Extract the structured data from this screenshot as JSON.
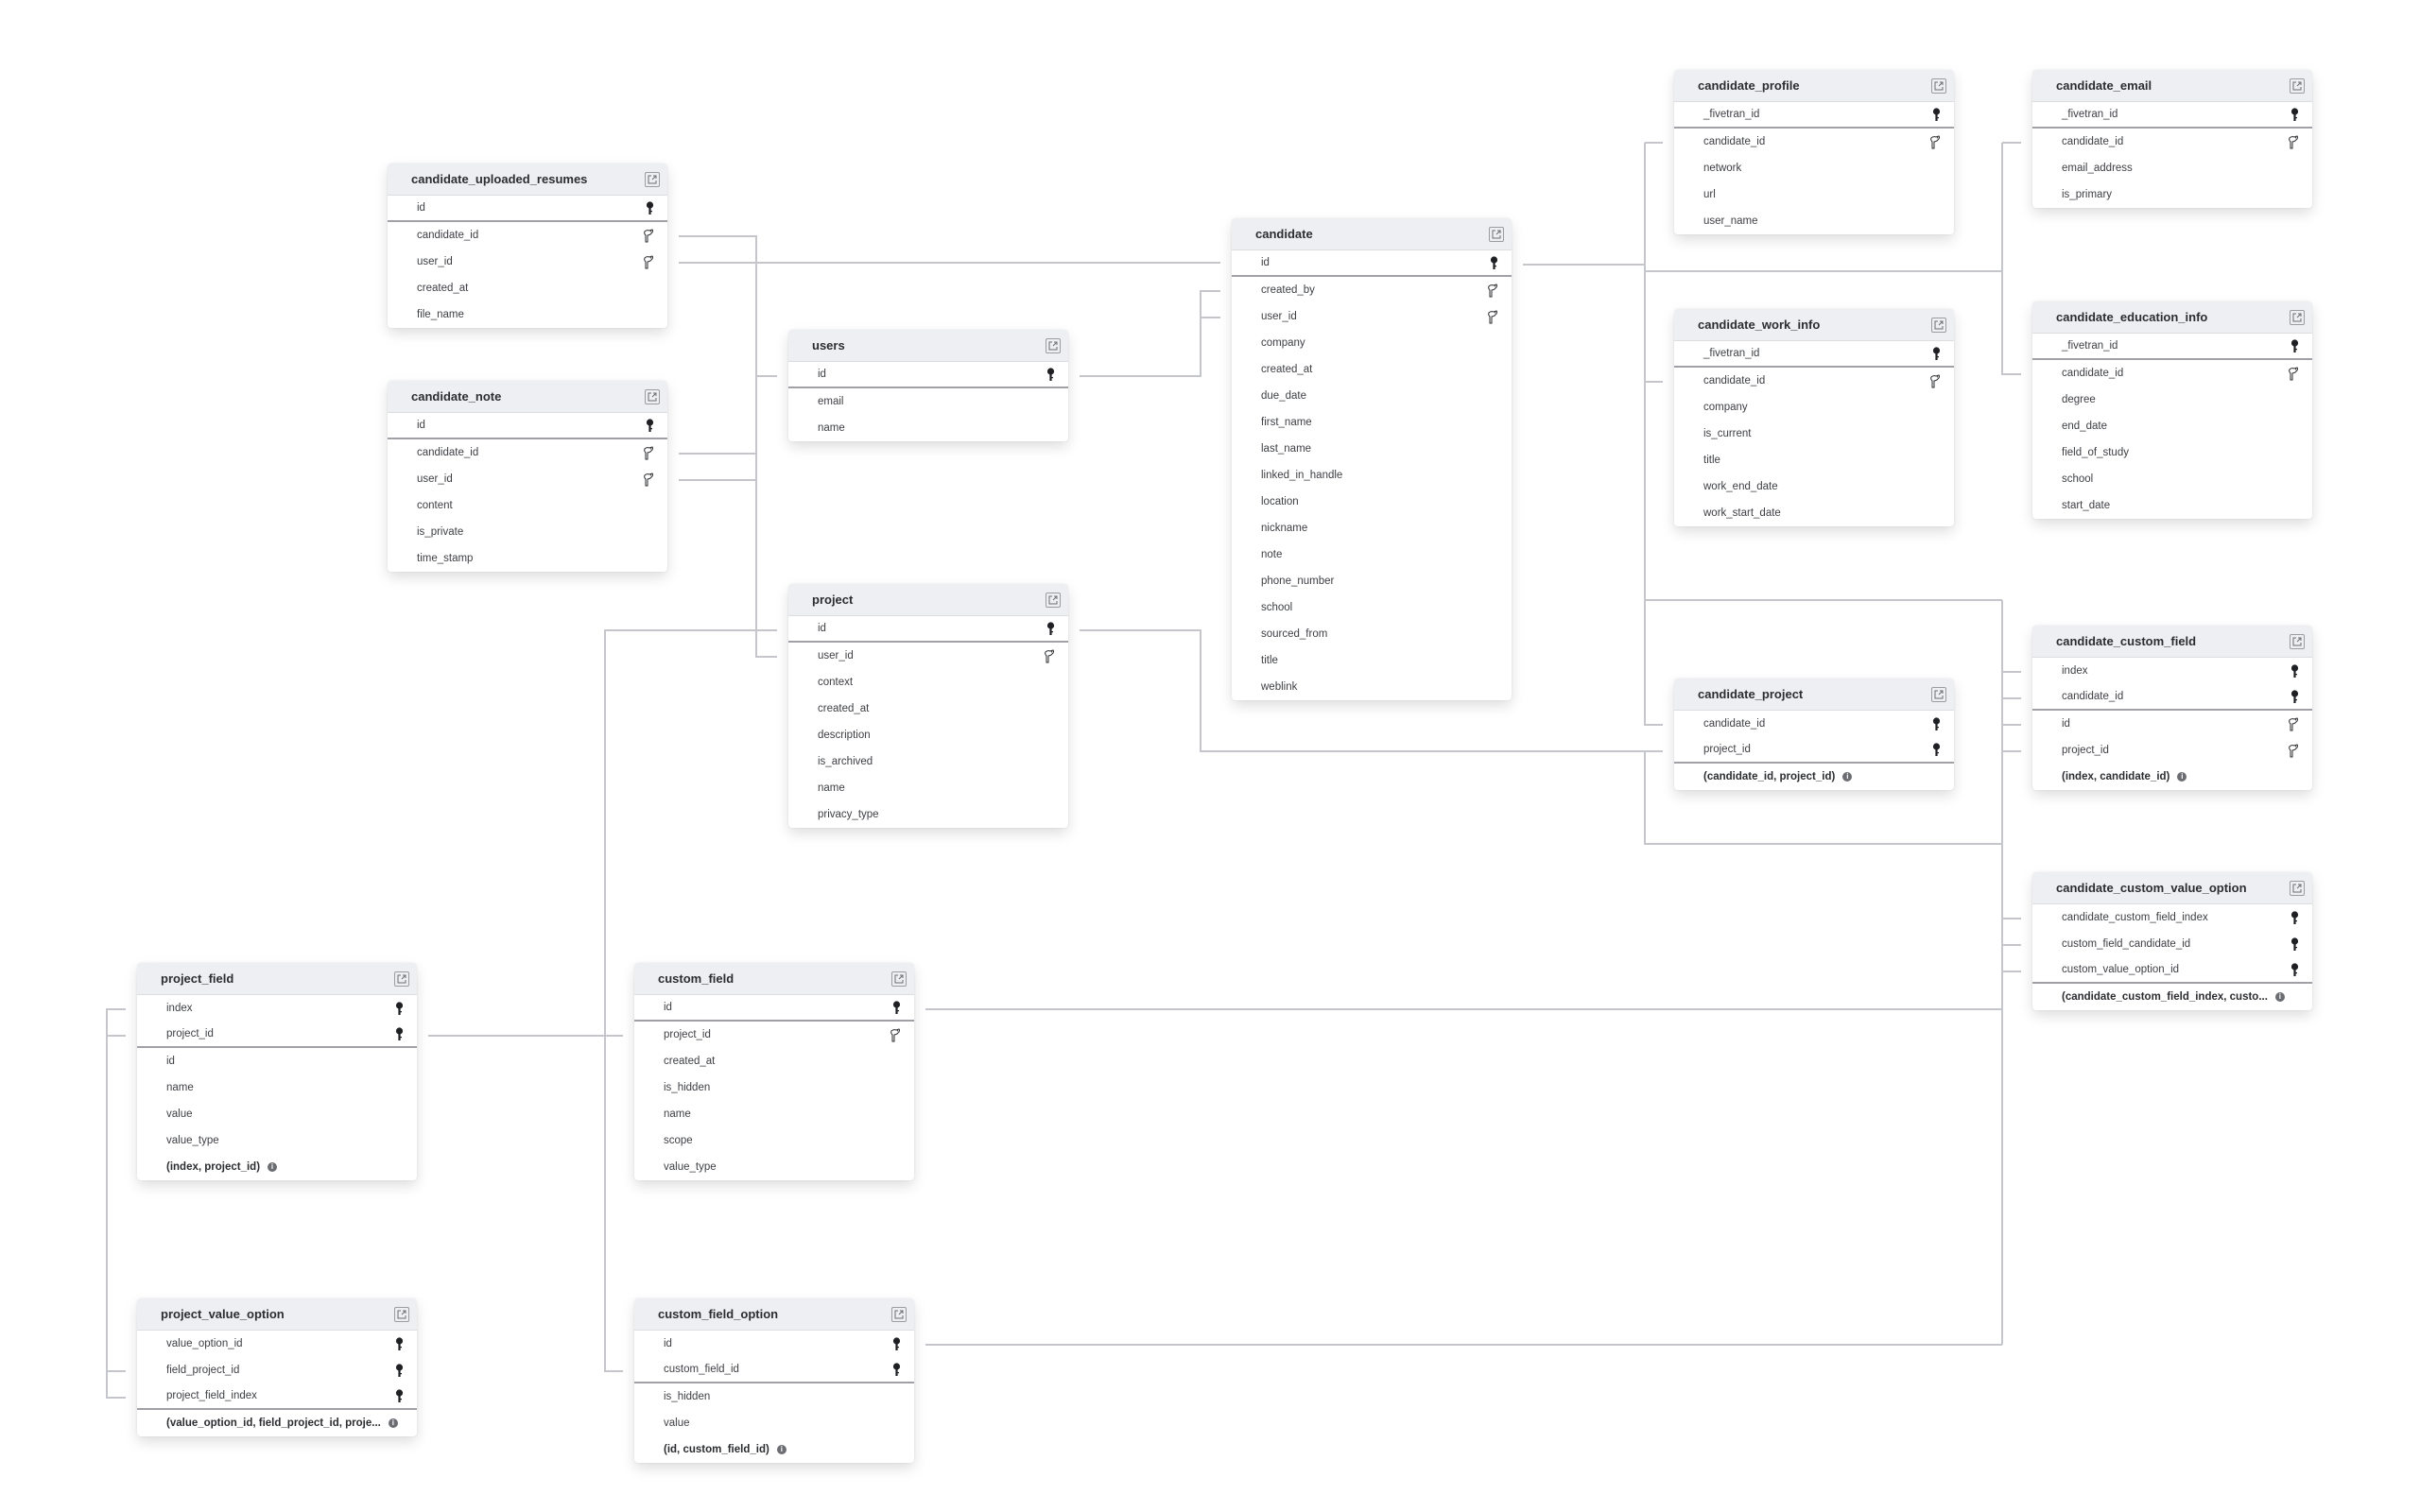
{
  "diagram": {
    "type": "entity-relationship",
    "tables": [
      {
        "name": "candidate_uploaded_resumes",
        "columns": [
          {
            "name": "id",
            "key": "pk"
          },
          {
            "name": "candidate_id",
            "key": "fk"
          },
          {
            "name": "user_id",
            "key": "fk"
          },
          {
            "name": "created_at"
          },
          {
            "name": "file_name"
          }
        ]
      },
      {
        "name": "candidate_note",
        "columns": [
          {
            "name": "id",
            "key": "pk"
          },
          {
            "name": "candidate_id",
            "key": "fk"
          },
          {
            "name": "user_id",
            "key": "fk"
          },
          {
            "name": "content"
          },
          {
            "name": "is_private"
          },
          {
            "name": "time_stamp"
          }
        ]
      },
      {
        "name": "users",
        "columns": [
          {
            "name": "id",
            "key": "pk"
          },
          {
            "name": "email"
          },
          {
            "name": "name"
          }
        ]
      },
      {
        "name": "project",
        "columns": [
          {
            "name": "id",
            "key": "pk"
          },
          {
            "name": "user_id",
            "key": "fk"
          },
          {
            "name": "context"
          },
          {
            "name": "created_at"
          },
          {
            "name": "description"
          },
          {
            "name": "is_archived"
          },
          {
            "name": "name"
          },
          {
            "name": "privacy_type"
          }
        ]
      },
      {
        "name": "candidate",
        "columns": [
          {
            "name": "id",
            "key": "pk"
          },
          {
            "name": "created_by",
            "key": "fk"
          },
          {
            "name": "user_id",
            "key": "fk"
          },
          {
            "name": "company"
          },
          {
            "name": "created_at"
          },
          {
            "name": "due_date"
          },
          {
            "name": "first_name"
          },
          {
            "name": "last_name"
          },
          {
            "name": "linked_in_handle"
          },
          {
            "name": "location"
          },
          {
            "name": "nickname"
          },
          {
            "name": "note"
          },
          {
            "name": "phone_number"
          },
          {
            "name": "school"
          },
          {
            "name": "sourced_from"
          },
          {
            "name": "title"
          },
          {
            "name": "weblink"
          }
        ]
      },
      {
        "name": "candidate_profile",
        "columns": [
          {
            "name": "_fivetran_id",
            "key": "pk"
          },
          {
            "name": "candidate_id",
            "key": "fk"
          },
          {
            "name": "network"
          },
          {
            "name": "url"
          },
          {
            "name": "user_name"
          }
        ]
      },
      {
        "name": "candidate_email",
        "columns": [
          {
            "name": "_fivetran_id",
            "key": "pk"
          },
          {
            "name": "candidate_id",
            "key": "fk"
          },
          {
            "name": "email_address"
          },
          {
            "name": "is_primary"
          }
        ]
      },
      {
        "name": "candidate_work_info",
        "columns": [
          {
            "name": "_fivetran_id",
            "key": "pk"
          },
          {
            "name": "candidate_id",
            "key": "fk"
          },
          {
            "name": "company"
          },
          {
            "name": "is_current"
          },
          {
            "name": "title"
          },
          {
            "name": "work_end_date"
          },
          {
            "name": "work_start_date"
          }
        ]
      },
      {
        "name": "candidate_education_info",
        "columns": [
          {
            "name": "_fivetran_id",
            "key": "pk"
          },
          {
            "name": "candidate_id",
            "key": "fk"
          },
          {
            "name": "degree"
          },
          {
            "name": "end_date"
          },
          {
            "name": "field_of_study"
          },
          {
            "name": "school"
          },
          {
            "name": "start_date"
          }
        ]
      },
      {
        "name": "candidate_project",
        "columns": [
          {
            "name": "candidate_id",
            "key": "pk"
          },
          {
            "name": "project_id",
            "key": "pk"
          }
        ],
        "composite_key": "(candidate_id, project_id)"
      },
      {
        "name": "candidate_custom_field",
        "columns": [
          {
            "name": "index",
            "key": "pk"
          },
          {
            "name": "candidate_id",
            "key": "pk"
          },
          {
            "name": "id",
            "key": "fk"
          },
          {
            "name": "project_id",
            "key": "fk"
          }
        ],
        "composite_key": "(index, candidate_id)"
      },
      {
        "name": "candidate_custom_value_option",
        "columns": [
          {
            "name": "candidate_custom_field_index",
            "key": "pk"
          },
          {
            "name": "custom_field_candidate_id",
            "key": "pk"
          },
          {
            "name": "custom_value_option_id",
            "key": "pk"
          }
        ],
        "composite_key": "(candidate_custom_field_index, custo..."
      },
      {
        "name": "project_field",
        "columns": [
          {
            "name": "index",
            "key": "pk"
          },
          {
            "name": "project_id",
            "key": "pk"
          },
          {
            "name": "id"
          },
          {
            "name": "name"
          },
          {
            "name": "value"
          },
          {
            "name": "value_type"
          }
        ],
        "composite_key": "(index, project_id)"
      },
      {
        "name": "project_value_option",
        "columns": [
          {
            "name": "value_option_id",
            "key": "pk"
          },
          {
            "name": "field_project_id",
            "key": "pk"
          },
          {
            "name": "project_field_index",
            "key": "pk"
          }
        ],
        "composite_key": "(value_option_id, field_project_id, proje..."
      },
      {
        "name": "custom_field",
        "columns": [
          {
            "name": "id",
            "key": "pk"
          },
          {
            "name": "project_id",
            "key": "fk"
          },
          {
            "name": "created_at"
          },
          {
            "name": "is_hidden"
          },
          {
            "name": "name"
          },
          {
            "name": "scope"
          },
          {
            "name": "value_type"
          }
        ]
      },
      {
        "name": "custom_field_option",
        "columns": [
          {
            "name": "id",
            "key": "pk"
          },
          {
            "name": "custom_field_id",
            "key": "pk"
          },
          {
            "name": "is_hidden"
          },
          {
            "name": "value"
          }
        ],
        "composite_key": "(id, custom_field_id)"
      }
    ],
    "relationships": [
      {
        "from": "candidate_uploaded_resumes.candidate_id",
        "to": "candidate.id"
      },
      {
        "from": "candidate_uploaded_resumes.user_id",
        "to": "users.id"
      },
      {
        "from": "candidate_note.candidate_id",
        "to": "candidate.id"
      },
      {
        "from": "candidate_note.user_id",
        "to": "users.id"
      },
      {
        "from": "project.user_id",
        "to": "users.id"
      },
      {
        "from": "candidate.created_by",
        "to": "users.id"
      },
      {
        "from": "candidate.user_id",
        "to": "users.id"
      },
      {
        "from": "candidate_profile.candidate_id",
        "to": "candidate.id"
      },
      {
        "from": "candidate_email.candidate_id",
        "to": "candidate.id"
      },
      {
        "from": "candidate_work_info.candidate_id",
        "to": "candidate.id"
      },
      {
        "from": "candidate_education_info.candidate_id",
        "to": "candidate.id"
      },
      {
        "from": "candidate_project.candidate_id",
        "to": "candidate.id"
      },
      {
        "from": "candidate_project.project_id",
        "to": "project.id"
      },
      {
        "from": "candidate_custom_field.candidate_id",
        "to": "candidate.id"
      },
      {
        "from": "candidate_custom_field.project_id",
        "to": "project.id"
      },
      {
        "from": "candidate_custom_field.id",
        "to": "custom_field.id"
      },
      {
        "from": "candidate_custom_value_option.candidate_custom_field_index",
        "to": "candidate_custom_field.index"
      },
      {
        "from": "candidate_custom_value_option.custom_field_candidate_id",
        "to": "candidate_custom_field.candidate_id"
      },
      {
        "from": "candidate_custom_value_option.custom_value_option_id",
        "to": "custom_field_option.id"
      },
      {
        "from": "custom_field.project_id",
        "to": "project.id"
      },
      {
        "from": "custom_field_option.custom_field_id",
        "to": "custom_field.id"
      },
      {
        "from": "project_field.project_id",
        "to": "project.id"
      },
      {
        "from": "project_value_option.field_project_id",
        "to": "project_field.project_id"
      },
      {
        "from": "project_value_option.project_field_index",
        "to": "project_field.index"
      }
    ]
  },
  "icons": {
    "primary_key": "key-icon",
    "foreign_key": "foreign-key-icon",
    "open_table": "external-link-icon",
    "composite_info": "info-icon"
  },
  "colors": {
    "header_bg": "#eeeff2",
    "connector": "#c4c6cc",
    "text": "#3d3f44",
    "title": "#2b2d31"
  }
}
